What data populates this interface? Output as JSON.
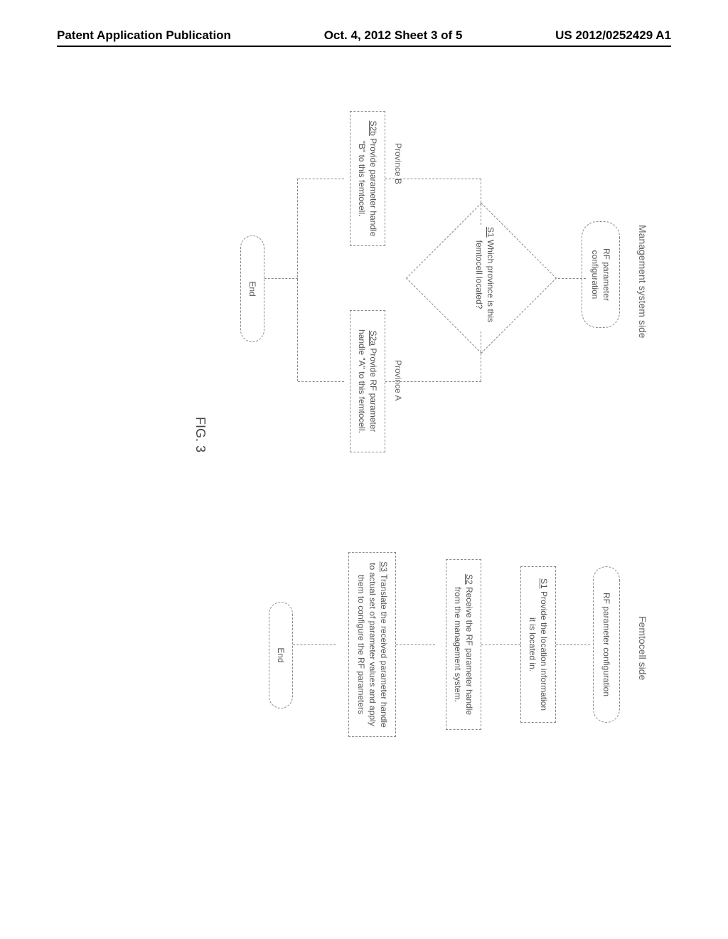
{
  "header": {
    "left": "Patent Application Publication",
    "center": "Oct. 4, 2012  Sheet 3 of 5",
    "right": "US 2012/0252429 A1"
  },
  "mgmt": {
    "side_label": "Management system side",
    "start": "RF parameter configuration",
    "s1_ref": "S1",
    "s1_text": "Which province is this femtocell located?",
    "branch_a": "Province A",
    "branch_b": "Province B",
    "s2a_ref": "S2a",
    "s2a_text": "Provide RF parameter handle \"A\" to this femtocell.",
    "s2b_ref": "S2b",
    "s2b_text": "Provide parameter handle \"B\" to this femtocell.",
    "end": "End"
  },
  "femto": {
    "side_label": "Femtocell side",
    "start": "RF parameter configuration",
    "s1_ref": "S1",
    "s1_text": "Provide the location information it is located in.",
    "s2_ref": "S2",
    "s2_text": "Receive the RF parameter handle from the management system.",
    "s3_ref": "S3",
    "s3_text": "Translate the received parameter handle to actual set of parameter values and apply them to configure the RF parameters",
    "end": "End"
  },
  "figure_label": "FIG. 3"
}
